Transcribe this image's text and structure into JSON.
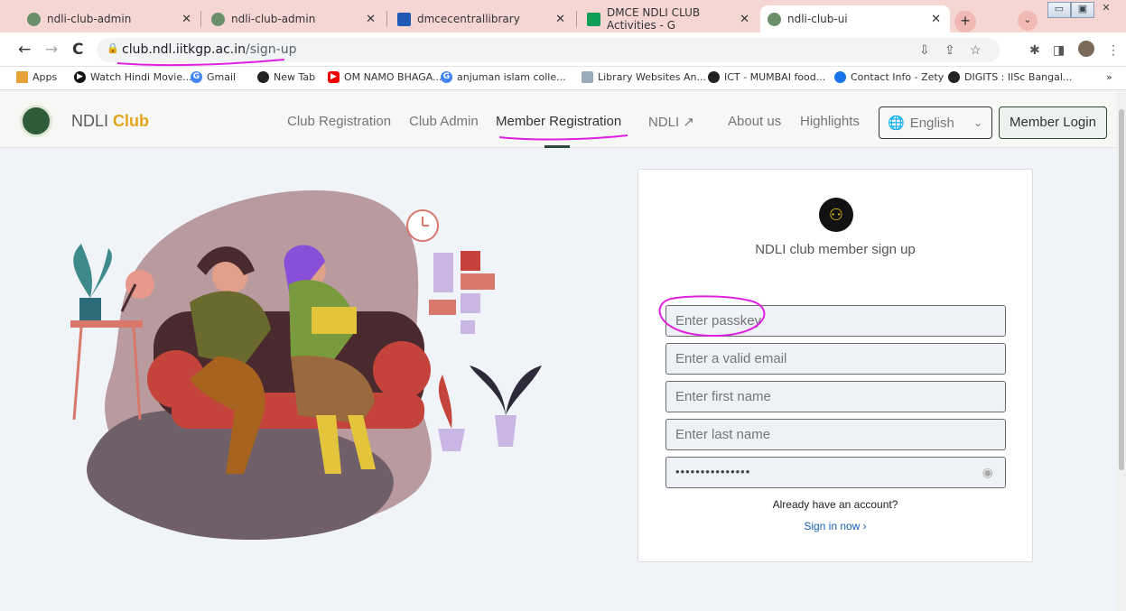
{
  "browser": {
    "tabs": [
      {
        "title": "ndli-club-admin",
        "icon": "globe-icon"
      },
      {
        "title": "ndli-club-admin",
        "icon": "globe-icon"
      },
      {
        "title": "dmcecentrallibrary",
        "icon": "site-icon"
      },
      {
        "title": "DMCE NDLI CLUB Activities - G",
        "icon": "sheets-icon"
      },
      {
        "title": "ndli-club-ui",
        "icon": "globe-icon",
        "active": true
      }
    ],
    "url_host": "club.ndl.iitkgp.ac.in",
    "url_path": "/sign-up",
    "bookmarks": [
      "Apps",
      "Watch Hindi Movie...",
      "Gmail",
      "New Tab",
      "OM NAMO BHAGA...",
      "anjuman islam colle...",
      "Library Websites An...",
      "ICT - MUMBAI food...",
      "Contact Info - Zety",
      "DIGITS : IISc Bangal..."
    ],
    "more_bookmarks": "»"
  },
  "site": {
    "brand_prefix": "NDLI",
    "brand_suffix": "Club",
    "nav": [
      "Club Registration",
      "Club Admin",
      "Member Registration",
      "NDLI",
      "About us",
      "Highlights"
    ],
    "language": "English",
    "login_label": "Member Login"
  },
  "signup": {
    "title": "NDLI club member sign up",
    "passkey_placeholder": "Enter passkey",
    "email_placeholder": "Enter a valid email",
    "first_name_placeholder": "Enter first name",
    "last_name_placeholder": "Enter last name",
    "password_value": "•••••••••••••••",
    "already_text": "Already have an account?",
    "signin_text": "Sign in now ›"
  },
  "colors": {
    "tab_strip": "#f6d6d3",
    "brand_accent": "#e1a51c",
    "primary_dark": "#2b4a36",
    "annotation": "#e020e0"
  }
}
